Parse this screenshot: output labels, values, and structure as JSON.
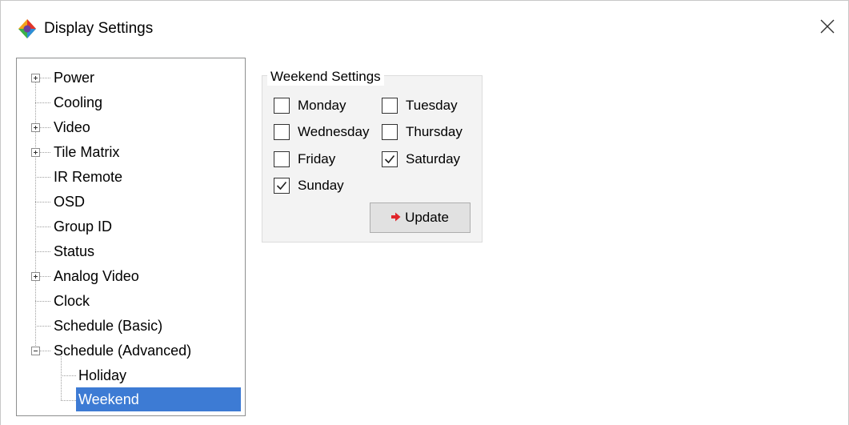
{
  "window": {
    "title": "Display Settings",
    "close_glyph": "✕",
    "app_icon": "display-settings-app-icon"
  },
  "tree": {
    "items": [
      {
        "label": "Power",
        "expander": "plus"
      },
      {
        "label": "Cooling",
        "expander": "none"
      },
      {
        "label": "Video",
        "expander": "plus"
      },
      {
        "label": "Tile Matrix",
        "expander": "plus"
      },
      {
        "label": "IR Remote",
        "expander": "none"
      },
      {
        "label": "OSD",
        "expander": "none"
      },
      {
        "label": "Group ID",
        "expander": "none"
      },
      {
        "label": "Status",
        "expander": "none"
      },
      {
        "label": "Analog Video",
        "expander": "plus"
      },
      {
        "label": "Clock",
        "expander": "none"
      },
      {
        "label": "Schedule (Basic)",
        "expander": "none"
      },
      {
        "label": "Schedule (Advanced)",
        "expander": "minus"
      },
      {
        "label": "Holiday",
        "expander": "none"
      },
      {
        "label": "Weekend",
        "expander": "none",
        "selected": true
      }
    ]
  },
  "weekend": {
    "group_title": "Weekend Settings",
    "days": [
      {
        "label": "Monday",
        "checked": false
      },
      {
        "label": "Tuesday",
        "checked": false
      },
      {
        "label": "Wednesday",
        "checked": false
      },
      {
        "label": "Thursday",
        "checked": false
      },
      {
        "label": "Friday",
        "checked": false
      },
      {
        "label": "Saturday",
        "checked": true
      },
      {
        "label": "Sunday",
        "checked": true
      }
    ],
    "update_label": "Update",
    "update_icon": "red-arrow-right-icon"
  },
  "colors": {
    "selection": "#3d7bd4",
    "update_arrow": "#e0262b",
    "group_background": "#f3f3f3"
  }
}
